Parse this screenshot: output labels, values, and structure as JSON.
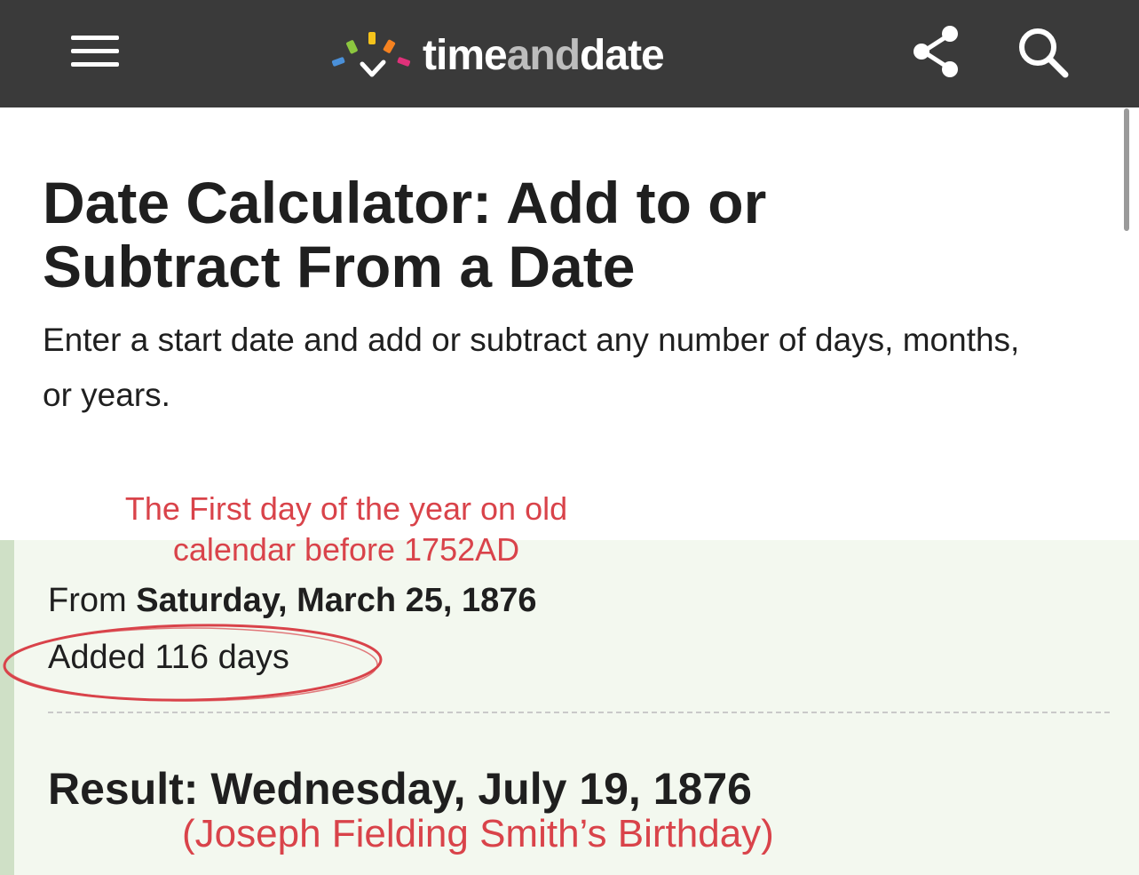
{
  "header": {
    "menu_icon": "hamburger-menu-icon",
    "logo": {
      "part1": "time",
      "part2": "and",
      "part3": "date",
      "dot_colors": [
        "#4a90d9",
        "#8cc63f",
        "#f5c31b",
        "#f58220",
        "#e0317a"
      ]
    },
    "share_icon": "share-icon",
    "search_icon": "search-icon",
    "bar_color": "#3a3a3a"
  },
  "page": {
    "title": "Date Calculator: Add to or Subtract From a Date",
    "intro": "Enter a start date and add or subtract any number of days, months, or years."
  },
  "result": {
    "from_prefix": "From",
    "from_date": "Saturday, March 25, 1876",
    "added": "Added 116 days",
    "result_text": "Result: Wednesday, July 19, 1876"
  },
  "annotations": {
    "note_first_day": "The First day of the year on old calendar before 1752AD",
    "note_birthday": "(Joseph Fielding Smith’s Birthday)",
    "annotation_color": "#d9434a"
  }
}
